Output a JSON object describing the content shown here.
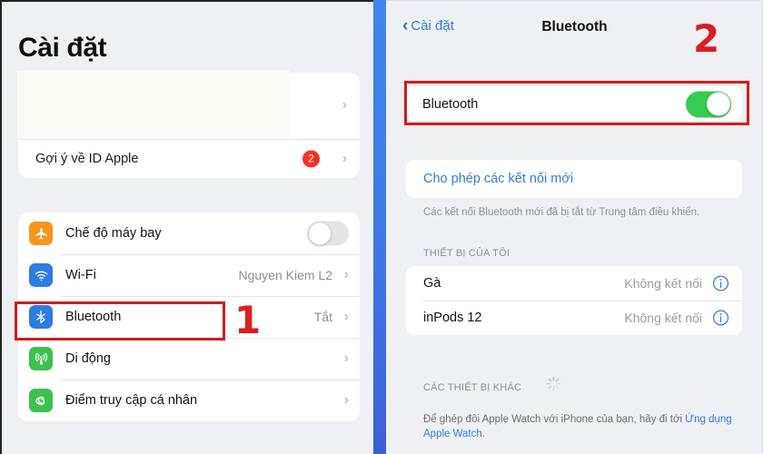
{
  "left_panel": {
    "title": "Cài đặt",
    "apple_id_card": {
      "profile_row_redacted": true,
      "suggestion_label": "Gợi ý về ID Apple",
      "badge_count": "2",
      "chevron": "chevron-right"
    },
    "network_rows": [
      {
        "icon": "airplane-icon",
        "icon_color": "#f79421",
        "label": "Chế độ máy bay",
        "control": "toggle",
        "toggle_on": false,
        "value": ""
      },
      {
        "icon": "wifi-icon",
        "icon_color": "#2f7ce0",
        "label": "Wi-Fi",
        "control": "chevron",
        "value": "Nguyen Kiem L2"
      },
      {
        "icon": "bluetooth-icon",
        "icon_color": "#2f7ce0",
        "label": "Bluetooth",
        "control": "chevron",
        "value": "Tắt"
      },
      {
        "icon": "cellular-icon",
        "icon_color": "#3cc14f",
        "label": "Di động",
        "control": "chevron",
        "value": ""
      },
      {
        "icon": "hotspot-icon",
        "icon_color": "#3cc14f",
        "label": "Điểm truy cập cá nhân",
        "control": "chevron",
        "value": ""
      }
    ]
  },
  "right_panel": {
    "nav": {
      "back_label": "Cài đặt",
      "back_icon": "chevron-left-icon",
      "title": "Bluetooth"
    },
    "bluetooth_toggle": {
      "label": "Bluetooth",
      "on": true
    },
    "allow_connections": {
      "label": "Cho phép các kết nối mới"
    },
    "hint_text": "Các kết nối Bluetooth mới đã bị tắt từ Trung tâm điều khiển.",
    "my_devices_header": "THIẾT BỊ CỦA TÔI",
    "devices": [
      {
        "name": "Gà",
        "status": "Không kết nối",
        "info_icon": "info-circle-icon"
      },
      {
        "name": "inPods 12",
        "status": "Không kết nối",
        "info_icon": "info-circle-icon"
      }
    ],
    "other_devices_header": "CÁC THIẾT BỊ KHÁC",
    "other_devices_spinner": "loading-spinner-icon",
    "footer": {
      "text_before": "Để ghép đôi Apple Watch với iPhone của bạn, hãy đi tới ",
      "link_text": "Ứng dụng Apple Watch",
      "text_after": "."
    }
  },
  "annotations": {
    "step_1": "1",
    "step_2": "2",
    "box_color": "#d31b1b",
    "number_color": "#d91f1f"
  },
  "theme": {
    "background": "#eff0f4",
    "card": "#ffffff",
    "accent_blue": "#2f7ce0",
    "toggle_on_green": "#36cc52",
    "badge_red": "#f63226",
    "divider_blue": "#3f7ee6"
  }
}
